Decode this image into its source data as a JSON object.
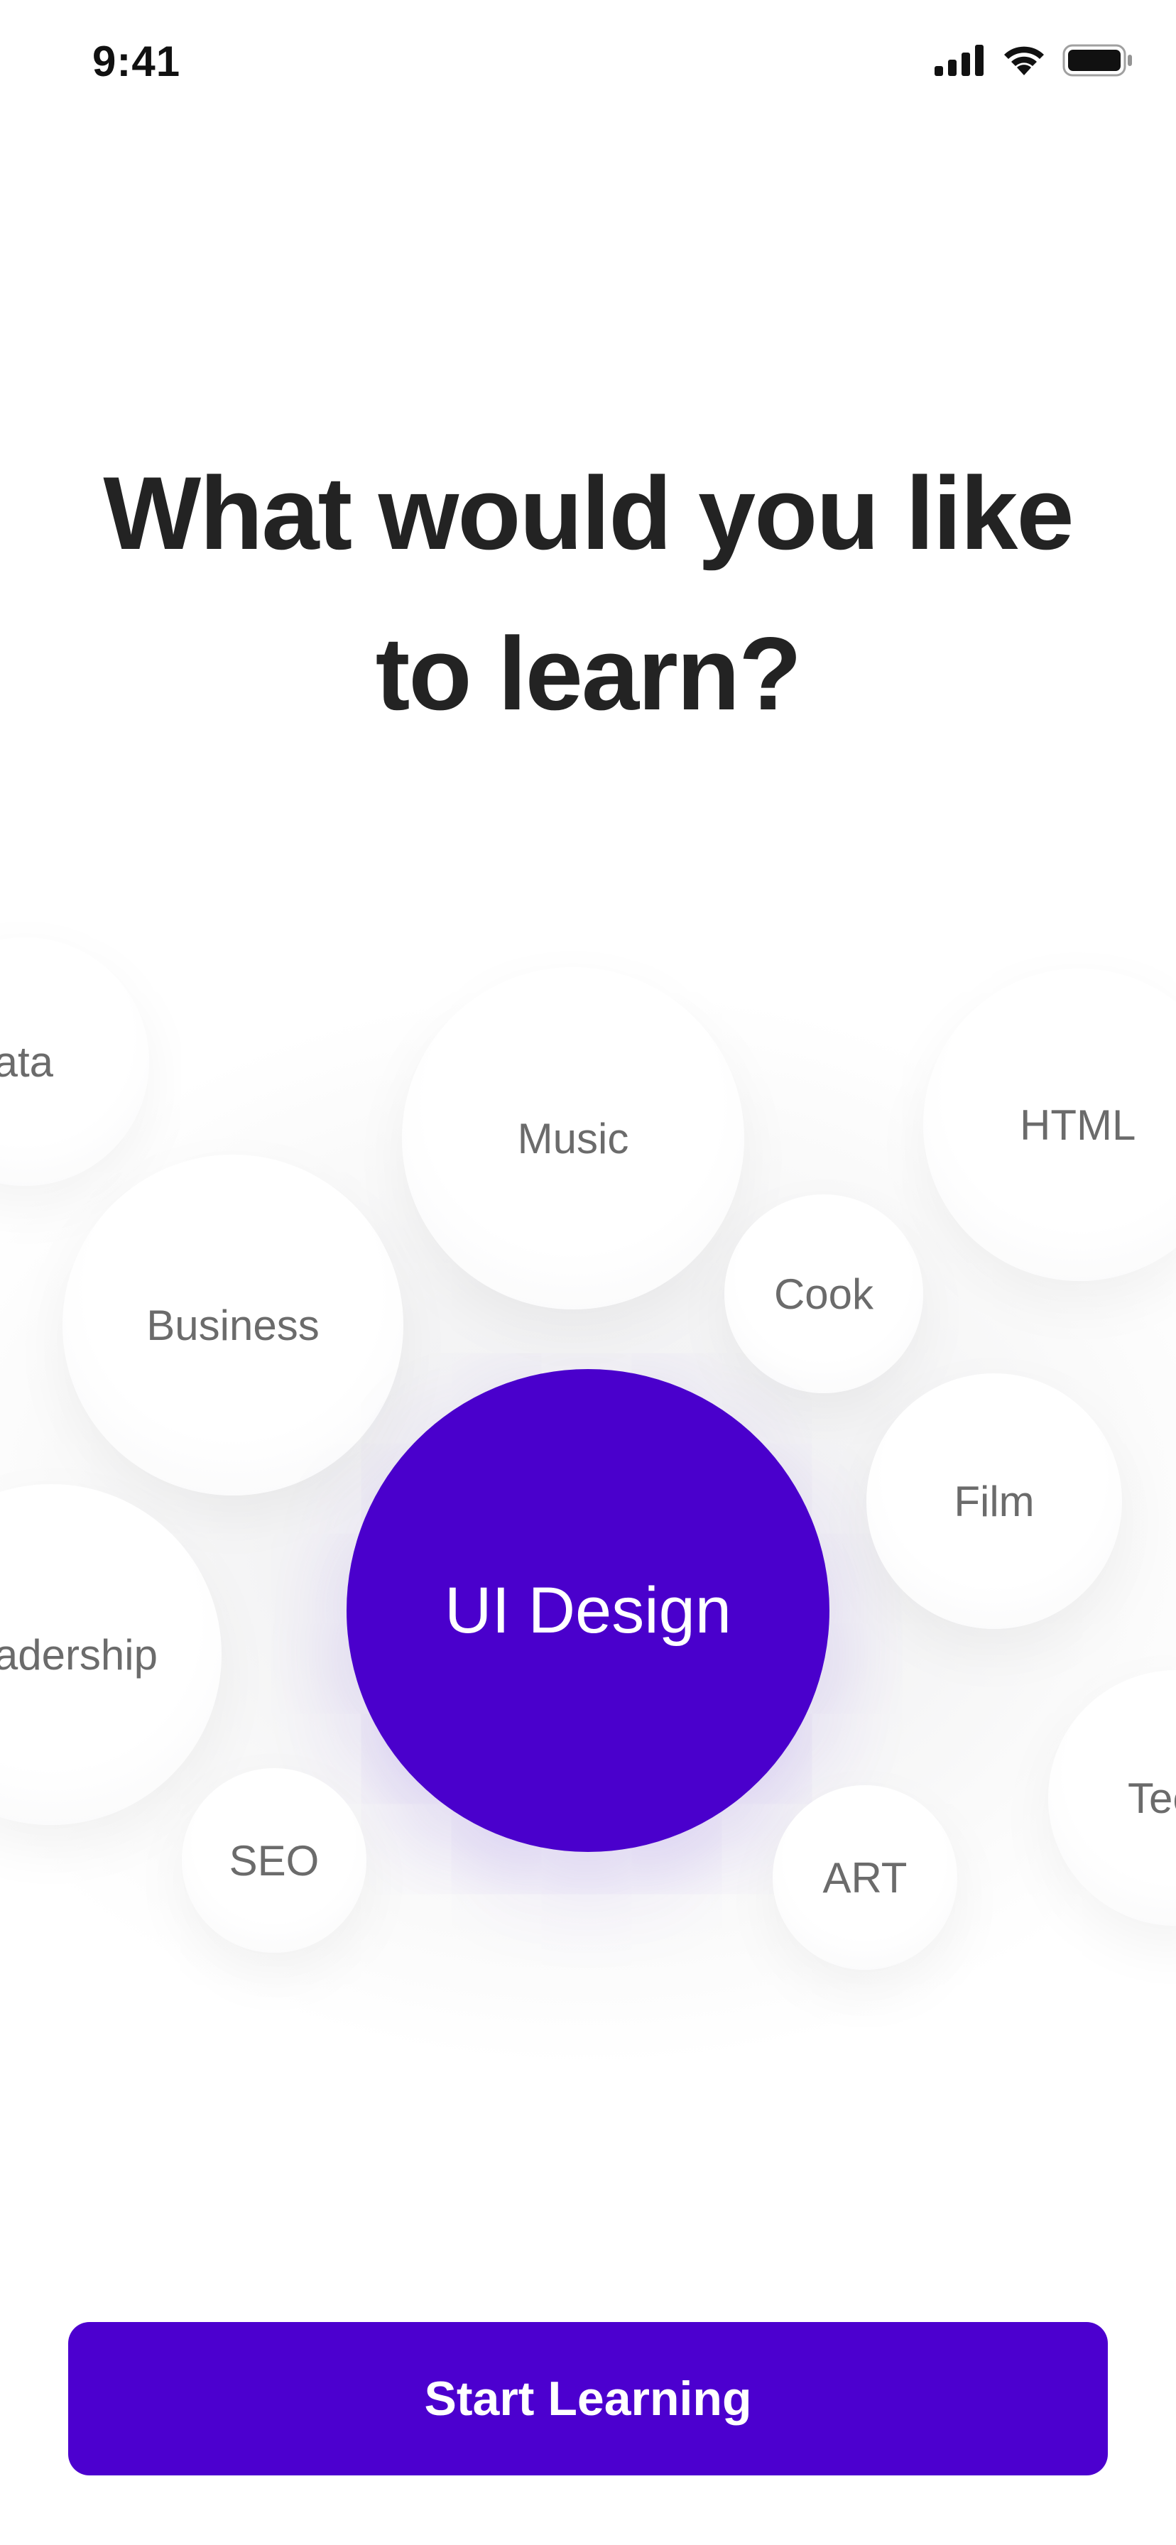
{
  "status_bar": {
    "time": "9:41",
    "icons": [
      "cellular-signal-icon",
      "wifi-icon",
      "battery-icon"
    ]
  },
  "heading": {
    "line1": "What would you like",
    "line2": "to learn?"
  },
  "topics": [
    {
      "label": "Data",
      "selected": false
    },
    {
      "label": "Music",
      "selected": false
    },
    {
      "label": "HTML",
      "selected": false
    },
    {
      "label": "Business",
      "selected": false
    },
    {
      "label": "Cook",
      "selected": false
    },
    {
      "label": "UI Design",
      "selected": true
    },
    {
      "label": "Film",
      "selected": false
    },
    {
      "label": "Leadership",
      "selected": false
    },
    {
      "label": "Tech",
      "selected": false
    },
    {
      "label": "SEO",
      "selected": false
    },
    {
      "label": "ART",
      "selected": false
    }
  ],
  "colors": {
    "accent": "#4c00cf",
    "selected_bubble": "#4a00cc",
    "bubble_text": "#6b6b6b",
    "heading_text": "#232323"
  },
  "actions": {
    "start_label": "Start Learning"
  }
}
